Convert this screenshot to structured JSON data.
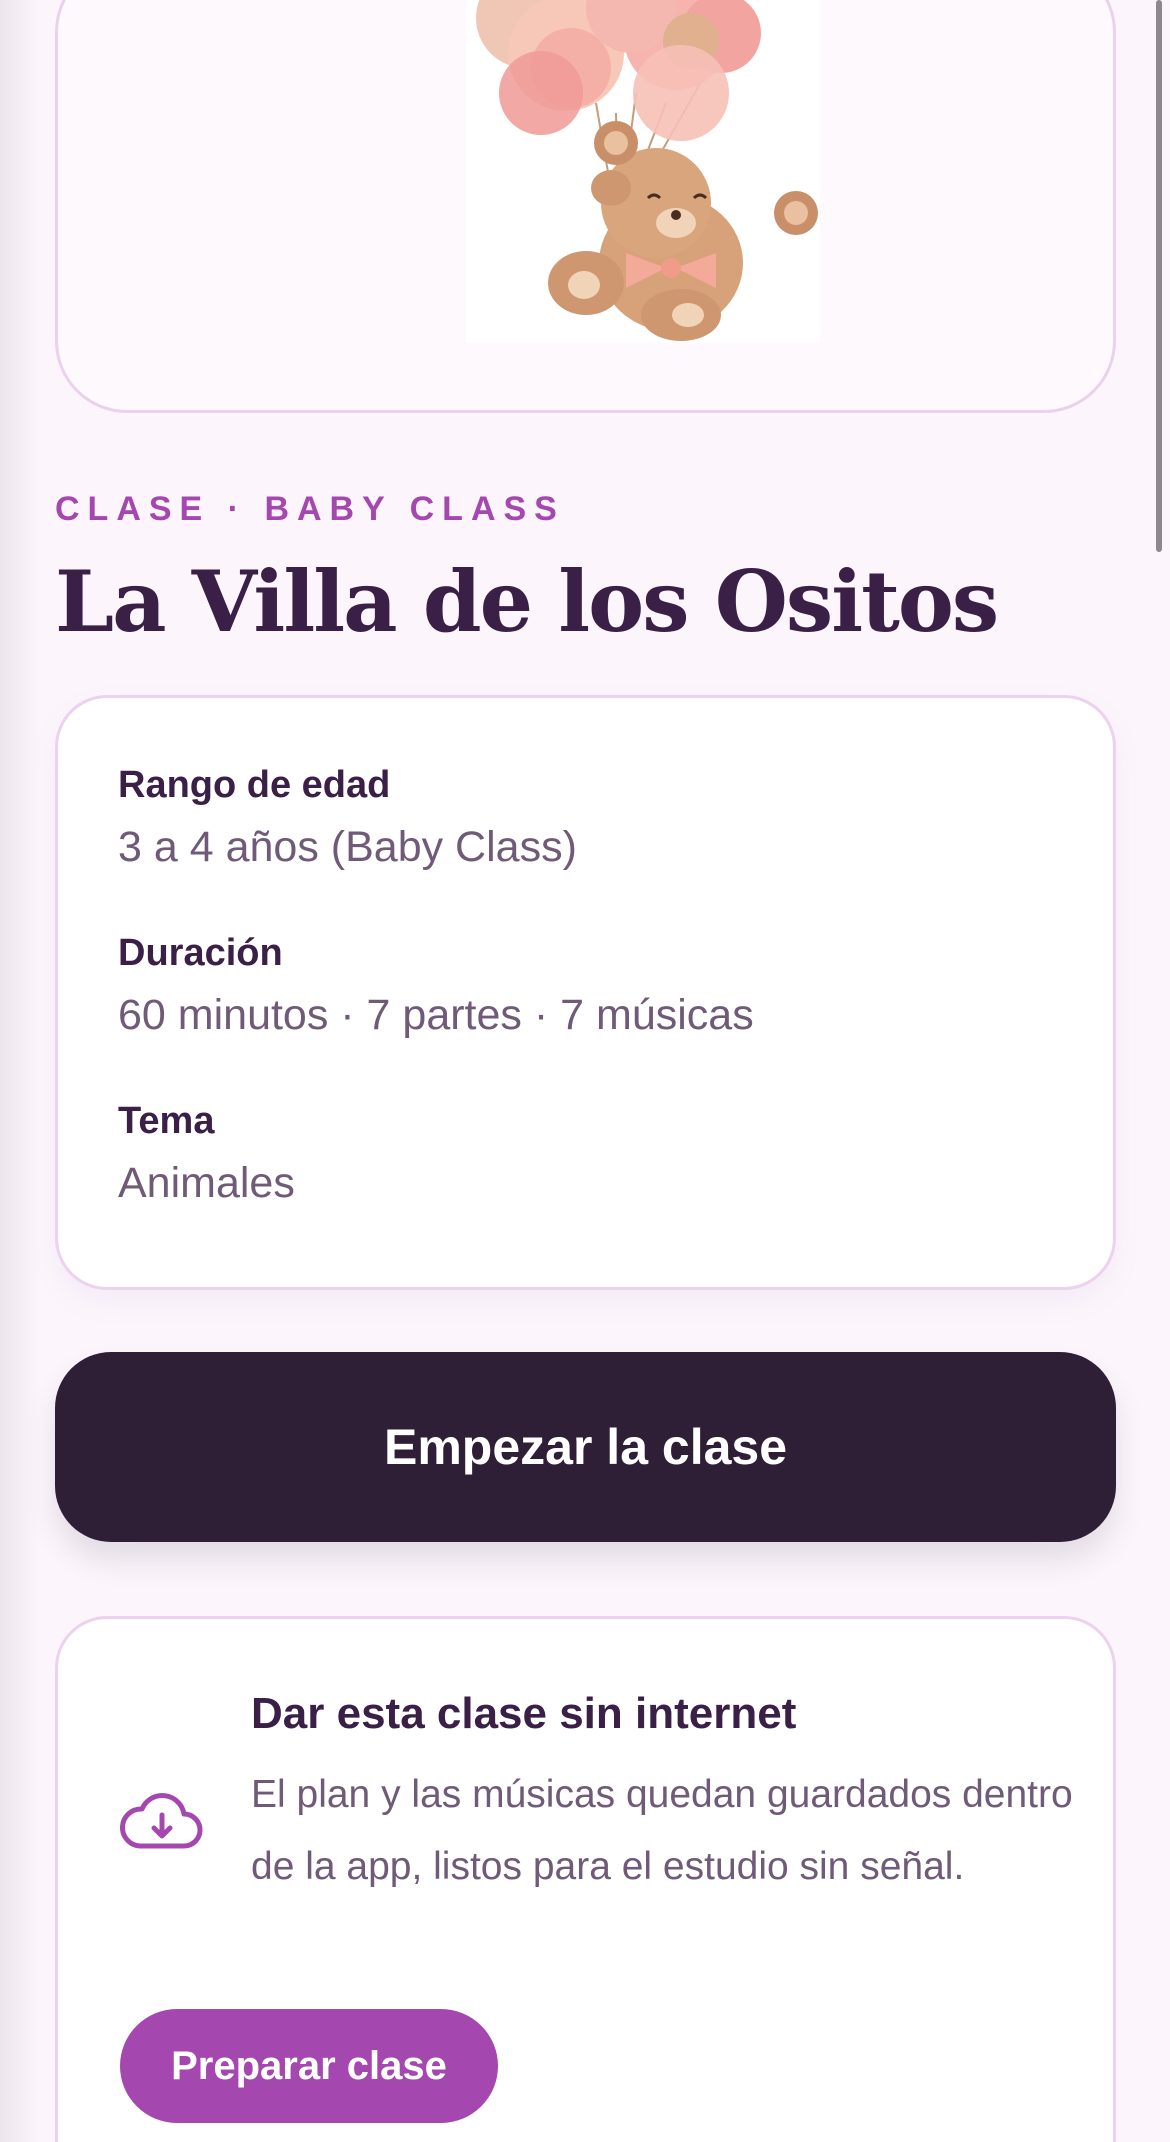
{
  "hero": {
    "image_alt": "teddy-bear-with-balloons-illustration"
  },
  "class_info": {
    "overline": "CLASE · BABY CLASS",
    "title": "La Villa de los Ositos",
    "details": [
      {
        "label": "Rango de edad",
        "value": "3 a 4 años (Baby Class)"
      },
      {
        "label": "Duración",
        "value": "60 minutos · 7 partes · 7 músicas"
      },
      {
        "label": "Tema",
        "value": "Animales"
      }
    ]
  },
  "actions": {
    "start_label": "Empezar la clase"
  },
  "offline": {
    "icon": "cloud-download-icon",
    "title": "Dar esta clase sin internet",
    "description": "El plan y las músicas quedan guardados dentro de la app, listos para el estudio sin señal.",
    "button_label": "Preparar clase"
  },
  "colors": {
    "accent": "#a448b0",
    "title": "#3a1f47",
    "primary_button": "#2f1f36",
    "muted_text": "#6f5b78",
    "card_border": "#ecd2ee",
    "background": "#fcf6fc"
  }
}
